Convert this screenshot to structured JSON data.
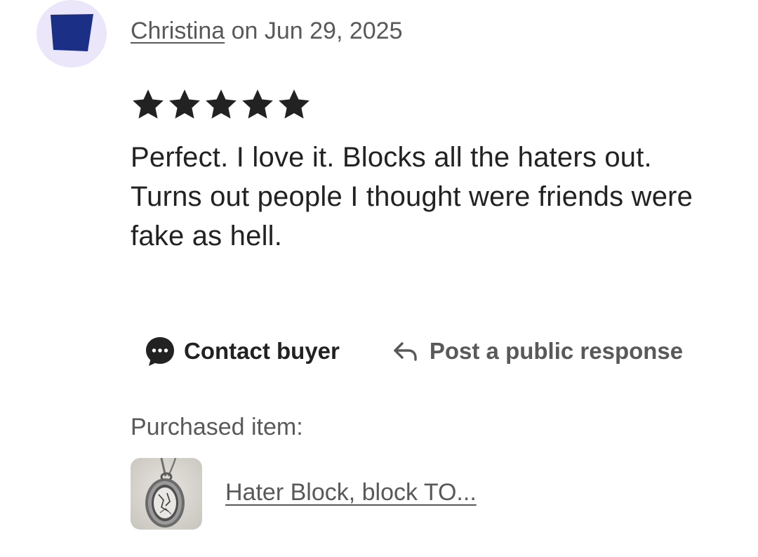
{
  "review": {
    "reviewer_name": "Christina",
    "date_text": " on Jun 29, 2025",
    "rating": 5,
    "rating_max": 5,
    "text": "Perfect. I love it. Blocks all the haters out. Turns out people I thought were friends were fake as hell."
  },
  "actions": {
    "contact_buyer_label": "Contact buyer",
    "public_response_label": "Post a public response"
  },
  "purchase": {
    "label": "Purchased item:",
    "item_title": "Hater Block, block TO..."
  },
  "icons": {
    "avatar": "avatar-image",
    "star": "star-icon",
    "contact": "chat-bubble-icon",
    "reply": "reply-arrow-icon"
  },
  "colors": {
    "avatar_bg": "#ece6fb",
    "avatar_shape": "#1b2f86",
    "text_dark": "#222222",
    "text_muted": "#595959"
  }
}
